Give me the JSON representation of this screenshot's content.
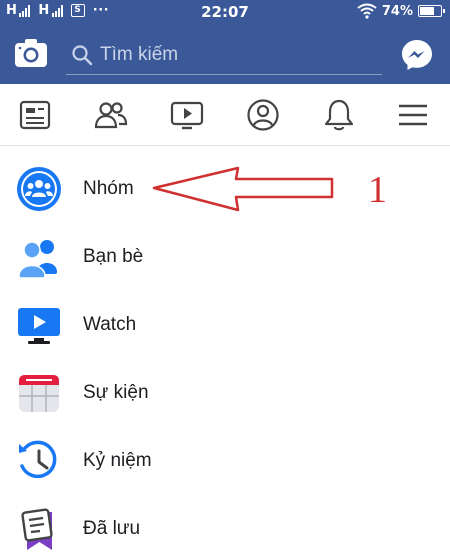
{
  "status_bar": {
    "carrier1": "H",
    "carrier2": "H",
    "sim_label": "S",
    "more": "···",
    "time": "22:07",
    "battery": "74%",
    "battery_level": 0.74
  },
  "header": {
    "search_placeholder": "Tìm kiếm",
    "camera_icon": "camera-icon",
    "messenger_icon": "messenger-icon"
  },
  "tabs": [
    {
      "name": "news-feed",
      "icon": "news-feed-icon"
    },
    {
      "name": "friends",
      "icon": "friends-icon"
    },
    {
      "name": "watch",
      "icon": "watch-icon"
    },
    {
      "name": "profile",
      "icon": "profile-icon"
    },
    {
      "name": "notifications",
      "icon": "bell-icon"
    },
    {
      "name": "menu",
      "icon": "hamburger-icon"
    }
  ],
  "menu": {
    "items": [
      {
        "label": "Nhóm",
        "icon": "groups-icon"
      },
      {
        "label": "Bạn bè",
        "icon": "friends-icon"
      },
      {
        "label": "Watch",
        "icon": "watch-icon"
      },
      {
        "label": "Sự kiện",
        "icon": "calendar-icon"
      },
      {
        "label": "Kỷ niệm",
        "icon": "memories-clock-icon"
      },
      {
        "label": "Đã lưu",
        "icon": "saved-bookmark-icon"
      }
    ]
  },
  "annotation": {
    "number": "1"
  },
  "colors": {
    "brand": "#3b5998",
    "annotation_red": "#d03030",
    "icon_blue": "#1877f2"
  }
}
